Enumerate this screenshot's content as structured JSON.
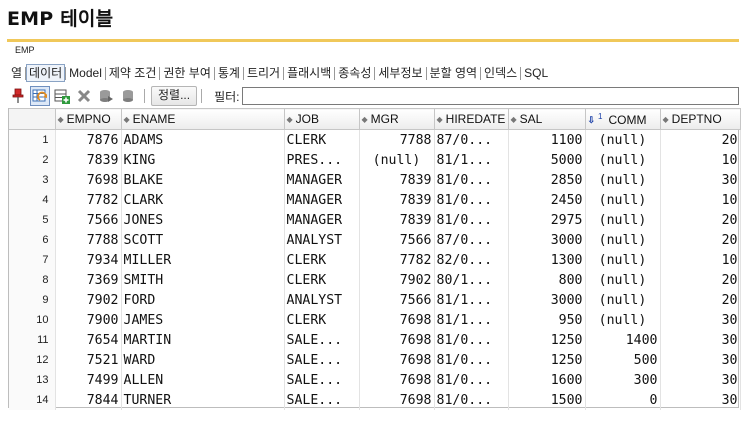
{
  "page_title": "EMP 테이블",
  "object_name": "EMP",
  "tabs": [
    {
      "label": "열",
      "active": false
    },
    {
      "label": "데이터",
      "active": true
    },
    {
      "label": "Model",
      "active": false
    },
    {
      "label": "제약 조건",
      "active": false
    },
    {
      "label": "권한 부여",
      "active": false
    },
    {
      "label": "통계",
      "active": false
    },
    {
      "label": "트리거",
      "active": false
    },
    {
      "label": "플래시백",
      "active": false
    },
    {
      "label": "종속성",
      "active": false
    },
    {
      "label": "세부정보",
      "active": false
    },
    {
      "label": "분할 영역",
      "active": false
    },
    {
      "label": "인덱스",
      "active": false
    },
    {
      "label": "SQL",
      "active": false
    }
  ],
  "toolbar": {
    "icons": [
      "pin-icon",
      "refresh-icon",
      "insert-row-icon",
      "delete-row-icon",
      "commit-icon",
      "rollback-icon"
    ],
    "sort_label": "정렬...",
    "filter_label": "필터:",
    "filter_value": ""
  },
  "grid": {
    "columns": [
      {
        "label": "EMPNO",
        "sorted": false
      },
      {
        "label": "ENAME",
        "sorted": false
      },
      {
        "label": "JOB",
        "sorted": false
      },
      {
        "label": "MGR",
        "sorted": false
      },
      {
        "label": "HIREDATE",
        "sorted": false
      },
      {
        "label": "SAL",
        "sorted": false
      },
      {
        "label": "COMM",
        "sorted": true,
        "sort_order": "1"
      },
      {
        "label": "DEPTNO",
        "sorted": false
      }
    ],
    "rows": [
      {
        "rownum": "1",
        "EMPNO": "7876",
        "ENAME": "ADAMS",
        "JOB": "CLERK",
        "MGR": "7788",
        "HIREDATE": "87/0...",
        "SAL": "1100",
        "COMM": "(null)",
        "DEPTNO": "20"
      },
      {
        "rownum": "2",
        "EMPNO": "7839",
        "ENAME": "KING",
        "JOB": "PRES...",
        "MGR": "(null)",
        "HIREDATE": "81/1...",
        "SAL": "5000",
        "COMM": "(null)",
        "DEPTNO": "10"
      },
      {
        "rownum": "3",
        "EMPNO": "7698",
        "ENAME": "BLAKE",
        "JOB": "MANAGER",
        "MGR": "7839",
        "HIREDATE": "81/0...",
        "SAL": "2850",
        "COMM": "(null)",
        "DEPTNO": "30"
      },
      {
        "rownum": "4",
        "EMPNO": "7782",
        "ENAME": "CLARK",
        "JOB": "MANAGER",
        "MGR": "7839",
        "HIREDATE": "81/0...",
        "SAL": "2450",
        "COMM": "(null)",
        "DEPTNO": "10"
      },
      {
        "rownum": "5",
        "EMPNO": "7566",
        "ENAME": "JONES",
        "JOB": "MANAGER",
        "MGR": "7839",
        "HIREDATE": "81/0...",
        "SAL": "2975",
        "COMM": "(null)",
        "DEPTNO": "20"
      },
      {
        "rownum": "6",
        "EMPNO": "7788",
        "ENAME": "SCOTT",
        "JOB": "ANALYST",
        "MGR": "7566",
        "HIREDATE": "87/0...",
        "SAL": "3000",
        "COMM": "(null)",
        "DEPTNO": "20"
      },
      {
        "rownum": "7",
        "EMPNO": "7934",
        "ENAME": "MILLER",
        "JOB": "CLERK",
        "MGR": "7782",
        "HIREDATE": "82/0...",
        "SAL": "1300",
        "COMM": "(null)",
        "DEPTNO": "10"
      },
      {
        "rownum": "8",
        "EMPNO": "7369",
        "ENAME": "SMITH",
        "JOB": "CLERK",
        "MGR": "7902",
        "HIREDATE": "80/1...",
        "SAL": "800",
        "COMM": "(null)",
        "DEPTNO": "20"
      },
      {
        "rownum": "9",
        "EMPNO": "7902",
        "ENAME": "FORD",
        "JOB": "ANALYST",
        "MGR": "7566",
        "HIREDATE": "81/1...",
        "SAL": "3000",
        "COMM": "(null)",
        "DEPTNO": "20"
      },
      {
        "rownum": "10",
        "EMPNO": "7900",
        "ENAME": "JAMES",
        "JOB": "CLERK",
        "MGR": "7698",
        "HIREDATE": "81/1...",
        "SAL": "950",
        "COMM": "(null)",
        "DEPTNO": "30"
      },
      {
        "rownum": "11",
        "EMPNO": "7654",
        "ENAME": "MARTIN",
        "JOB": "SALE...",
        "MGR": "7698",
        "HIREDATE": "81/0...",
        "SAL": "1250",
        "COMM": "1400",
        "DEPTNO": "30"
      },
      {
        "rownum": "12",
        "EMPNO": "7521",
        "ENAME": "WARD",
        "JOB": "SALE...",
        "MGR": "7698",
        "HIREDATE": "81/0...",
        "SAL": "1250",
        "COMM": "500",
        "DEPTNO": "30"
      },
      {
        "rownum": "13",
        "EMPNO": "7499",
        "ENAME": "ALLEN",
        "JOB": "SALE...",
        "MGR": "7698",
        "HIREDATE": "81/0...",
        "SAL": "1600",
        "COMM": "300",
        "DEPTNO": "30"
      },
      {
        "rownum": "14",
        "EMPNO": "7844",
        "ENAME": "TURNER",
        "JOB": "SALE...",
        "MGR": "7698",
        "HIREDATE": "81/0...",
        "SAL": "1500",
        "COMM": "0",
        "DEPTNO": "30"
      }
    ]
  },
  "colors": {
    "title_rule": "#f0c85a",
    "active_tab_border": "#8aa3c4",
    "sort_indicator": "#1a3fa8"
  }
}
